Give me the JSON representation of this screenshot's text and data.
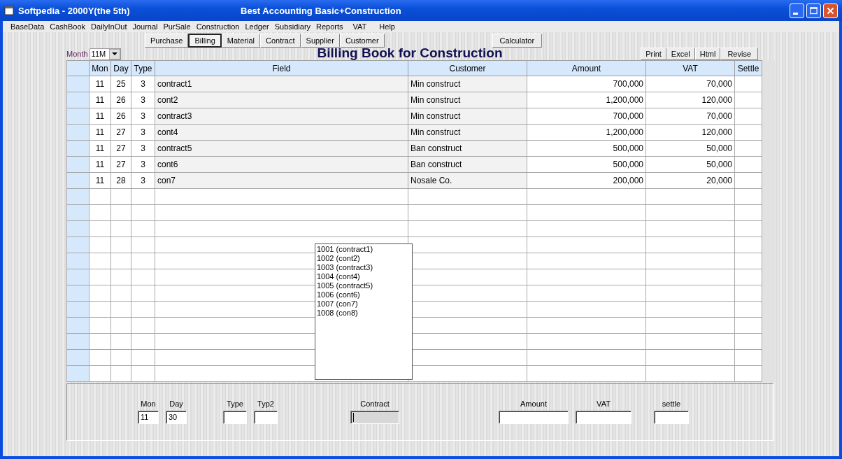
{
  "window": {
    "title": "Softpedia - 2000Y(the 5th)",
    "app_title": "Best Accounting Basic+Construction"
  },
  "menu": [
    "BaseData",
    "CashBook",
    "DailyInOut",
    "Journal",
    "PurSale",
    "Construction",
    "Ledger",
    "Subsidiary",
    "Reports",
    "VAT",
    "Help"
  ],
  "tabs": [
    {
      "label": "Purchase",
      "selected": false
    },
    {
      "label": "Billing",
      "selected": true
    },
    {
      "label": "Material",
      "selected": false
    },
    {
      "label": "Contract",
      "selected": false
    },
    {
      "label": "Supplier",
      "selected": false
    },
    {
      "label": "Customer",
      "selected": false
    }
  ],
  "calculator": "Calculator",
  "month": {
    "label": "Month",
    "value": "11M"
  },
  "heading": "Billing Book for Construction",
  "actions": [
    "Print",
    "Excel",
    "Html",
    "Revise"
  ],
  "table": {
    "columns": [
      "Mon",
      "Day",
      "Type",
      "Field",
      "Customer",
      "Amount",
      "VAT",
      "Settle"
    ],
    "rows": [
      [
        "11",
        "25",
        "3",
        "contract1",
        "Min construct",
        "700,000",
        "70,000"
      ],
      [
        "11",
        "26",
        "3",
        "cont2",
        "Min construct",
        "1,200,000",
        "120,000"
      ],
      [
        "11",
        "26",
        "3",
        "contract3",
        "Min construct",
        "700,000",
        "70,000"
      ],
      [
        "11",
        "27",
        "3",
        "cont4",
        "Min construct",
        "1,200,000",
        "120,000"
      ],
      [
        "11",
        "27",
        "3",
        "contract5",
        "Ban construct",
        "500,000",
        "50,000"
      ],
      [
        "11",
        "27",
        "3",
        "cont6",
        "Ban construct",
        "500,000",
        "50,000"
      ],
      [
        "11",
        "28",
        "3",
        "con7",
        "Nosale Co.",
        "200,000",
        "20,000"
      ]
    ]
  },
  "contract_list": [
    "1001 (contract1)",
    "1002 (cont2)",
    "1003 (contract3)",
    "1004 (cont4)",
    "1005 (contract5)",
    "1006 (cont6)",
    "1007 (con7)",
    "1008 (con8)"
  ],
  "form": [
    {
      "label": "Mon",
      "value": "11",
      "disabled": false
    },
    {
      "label": "Day",
      "value": "30",
      "disabled": false
    },
    {
      "label": "Type",
      "disabled": false
    },
    {
      "label": "Typ2",
      "disabled": false
    },
    {
      "label": "Contract",
      "disabled": true
    },
    {
      "label": "Amount",
      "disabled": false
    },
    {
      "label": "VAT",
      "disabled": false
    },
    {
      "label": "settle",
      "disabled": false
    }
  ]
}
